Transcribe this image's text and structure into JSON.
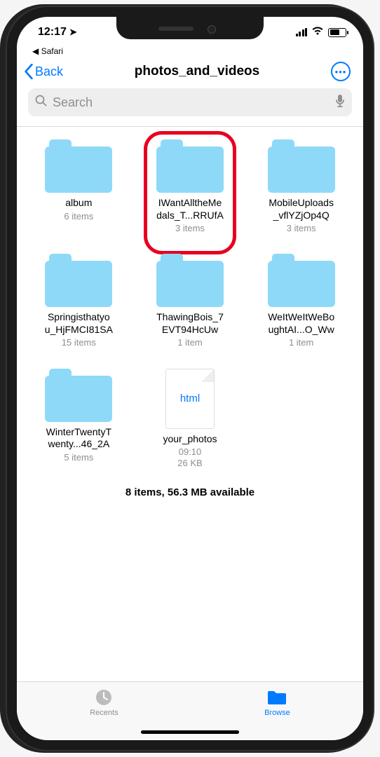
{
  "status": {
    "time": "12:17",
    "breadcrumb_app": "Safari"
  },
  "nav": {
    "back_label": "Back",
    "title": "photos_and_videos"
  },
  "search": {
    "placeholder": "Search"
  },
  "items": [
    {
      "type": "folder",
      "name1": "album",
      "name2": "",
      "meta": "6 items",
      "hl": false
    },
    {
      "type": "folder",
      "name1": "IWantAlltheMe",
      "name2": "dals_T...RRUfA",
      "meta": "3 items",
      "hl": true
    },
    {
      "type": "folder",
      "name1": "MobileUploads",
      "name2": "_vflYZjOp4Q",
      "meta": "3 items",
      "hl": false
    },
    {
      "type": "folder",
      "name1": "Springisthatyo",
      "name2": "u_HjFMCI81SA",
      "meta": "15 items",
      "hl": false
    },
    {
      "type": "folder",
      "name1": "ThawingBois_7",
      "name2": "EVT94HcUw",
      "meta": "1 item",
      "hl": false
    },
    {
      "type": "folder",
      "name1": "WeItWeItWeBo",
      "name2": "ughtAI...O_Ww",
      "meta": "1 item",
      "hl": false
    },
    {
      "type": "folder",
      "name1": "WinterTwentyT",
      "name2": "wenty...46_2A",
      "meta": "5 items",
      "hl": false
    },
    {
      "type": "file",
      "name1": "your_photos",
      "name2": "",
      "meta": "09:10\n26 KB",
      "badge": "html",
      "hl": false
    }
  ],
  "footer": {
    "summary": "8 items, 56.3 MB available"
  },
  "tabs": {
    "recents": "Recents",
    "browse": "Browse"
  }
}
